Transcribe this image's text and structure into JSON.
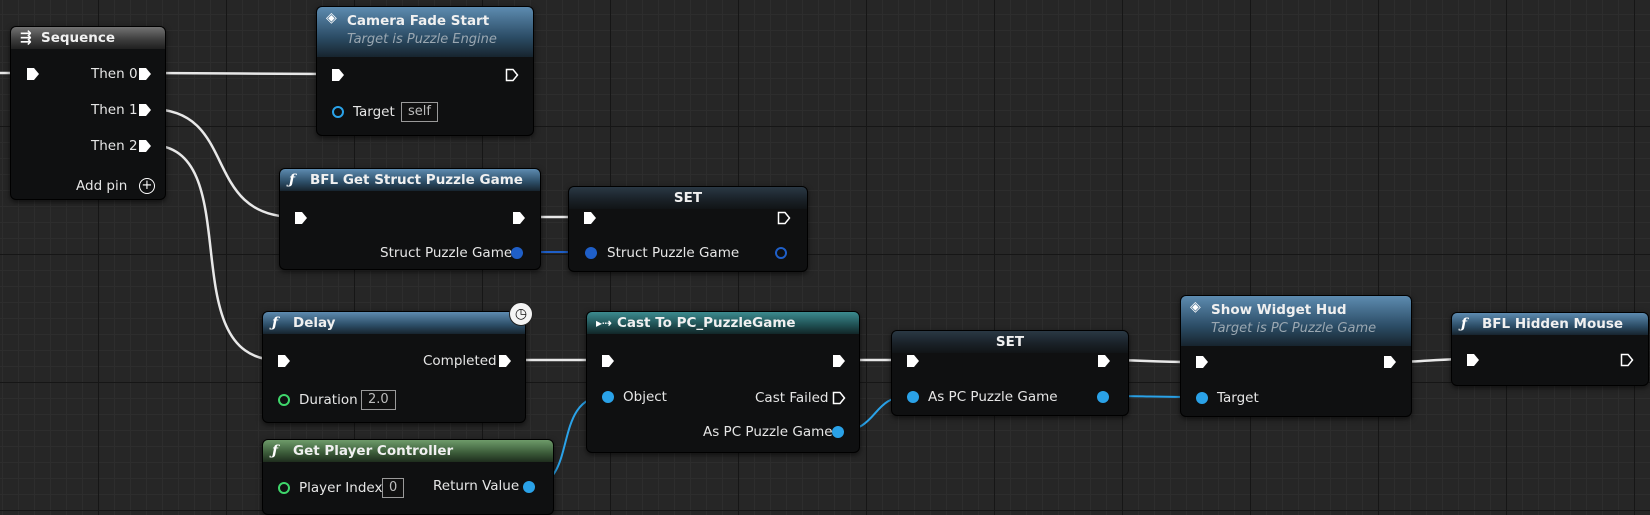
{
  "nodes": {
    "sequence": {
      "title": "Sequence",
      "outputs": [
        "Then 0",
        "Then 1",
        "Then 2"
      ],
      "add_pin": "Add pin"
    },
    "camera_fade": {
      "title": "Camera Fade Start",
      "subtitle": "Target is Puzzle Engine",
      "target_label": "Target",
      "target_value": "self"
    },
    "bfl_get_struct": {
      "title": "BFL Get Struct Puzzle Game",
      "output": "Struct Puzzle Game"
    },
    "set_struct": {
      "title": "SET",
      "input": "Struct Puzzle Game"
    },
    "delay": {
      "title": "Delay",
      "completed": "Completed",
      "duration_label": "Duration",
      "duration_value": "2.0"
    },
    "cast": {
      "title": "Cast To PC_PuzzleGame",
      "object": "Object",
      "cast_failed": "Cast Failed",
      "output": "As PC Puzzle Game"
    },
    "get_player_controller": {
      "title": "Get Player Controller",
      "player_index_label": "Player Index",
      "player_index_value": "0",
      "return_value": "Return Value"
    },
    "set_pc": {
      "title": "SET",
      "input": "As PC Puzzle Game"
    },
    "show_widget": {
      "title": "Show Widget Hud",
      "subtitle": "Target is PC Puzzle Game",
      "target_label": "Target"
    },
    "bfl_hidden_mouse": {
      "title": "BFL Hidden Mouse"
    }
  },
  "icons": {
    "function": "function-icon",
    "event": "event-diamond-icon",
    "sequence": "sequence-icon",
    "cast": "cast-icon",
    "latent": "clock-icon",
    "add": "add-pin-icon"
  },
  "colors": {
    "object_pin": "#2aa2e8",
    "struct_pin": "#1f5fc8",
    "int_pin": "#3fd66b",
    "float_pin": "#3fd66b",
    "exec_wire": "#ffffff"
  }
}
